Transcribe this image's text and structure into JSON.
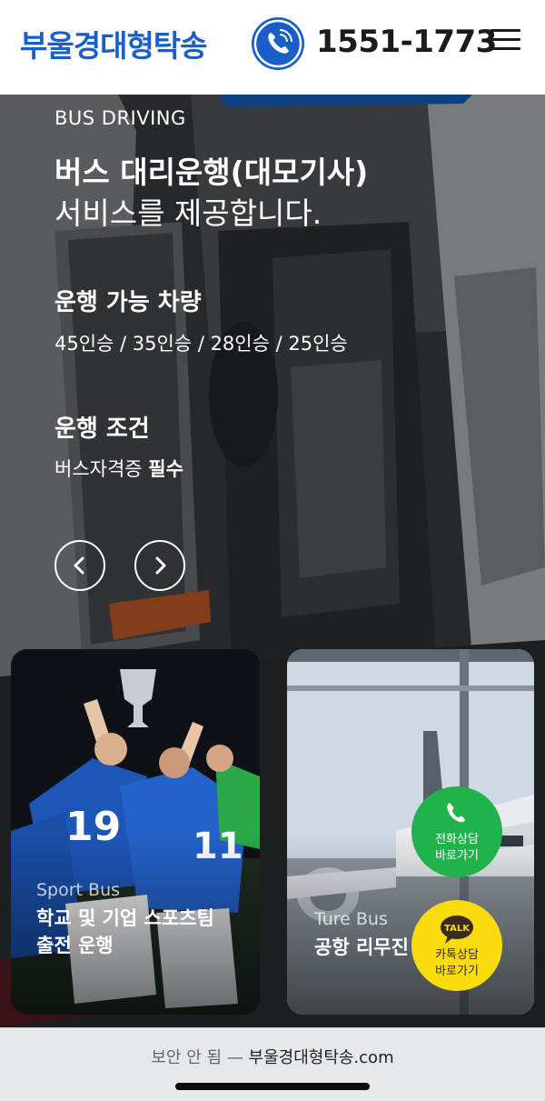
{
  "header": {
    "logo": "부울경대형탁송",
    "phone": "1551-1773",
    "phone_icon": "phone-icon",
    "menu_icon": "hamburger-menu-icon",
    "brand_color": "#1a5fc7"
  },
  "hero": {
    "subtitle": "BUS DRIVING",
    "title_line1": "버스 대리운행(대모기사)",
    "title_line2": "서비스를 제공합니다.",
    "section1": {
      "title": "운행 가능 차량",
      "body": "45인승 / 35인승 / 28인승 / 25인승"
    },
    "section2": {
      "title": "운행 조건",
      "body_prefix": "버스자격증 ",
      "body_bold": "필수"
    },
    "prev_icon": "chevron-left-icon",
    "next_icon": "chevron-right-icon"
  },
  "cards": [
    {
      "category": "Sport Bus",
      "title_line1": "학교 및 기업 스포츠팀",
      "title_line2": "출전 운행"
    },
    {
      "category": "Ture Bus",
      "title_line1": "공항 리무진 버스 운행"
    }
  ],
  "floating": {
    "call": {
      "line1": "전화상담",
      "line2": "바로가기",
      "color": "#21b24b"
    },
    "kakao": {
      "badge": "TALK",
      "line1": "카톡상담",
      "line2": "바로가기",
      "color": "#f8dc0e"
    }
  },
  "browser": {
    "security": "보안 안 됨 —",
    "url": "부울경대형탁송.com"
  }
}
